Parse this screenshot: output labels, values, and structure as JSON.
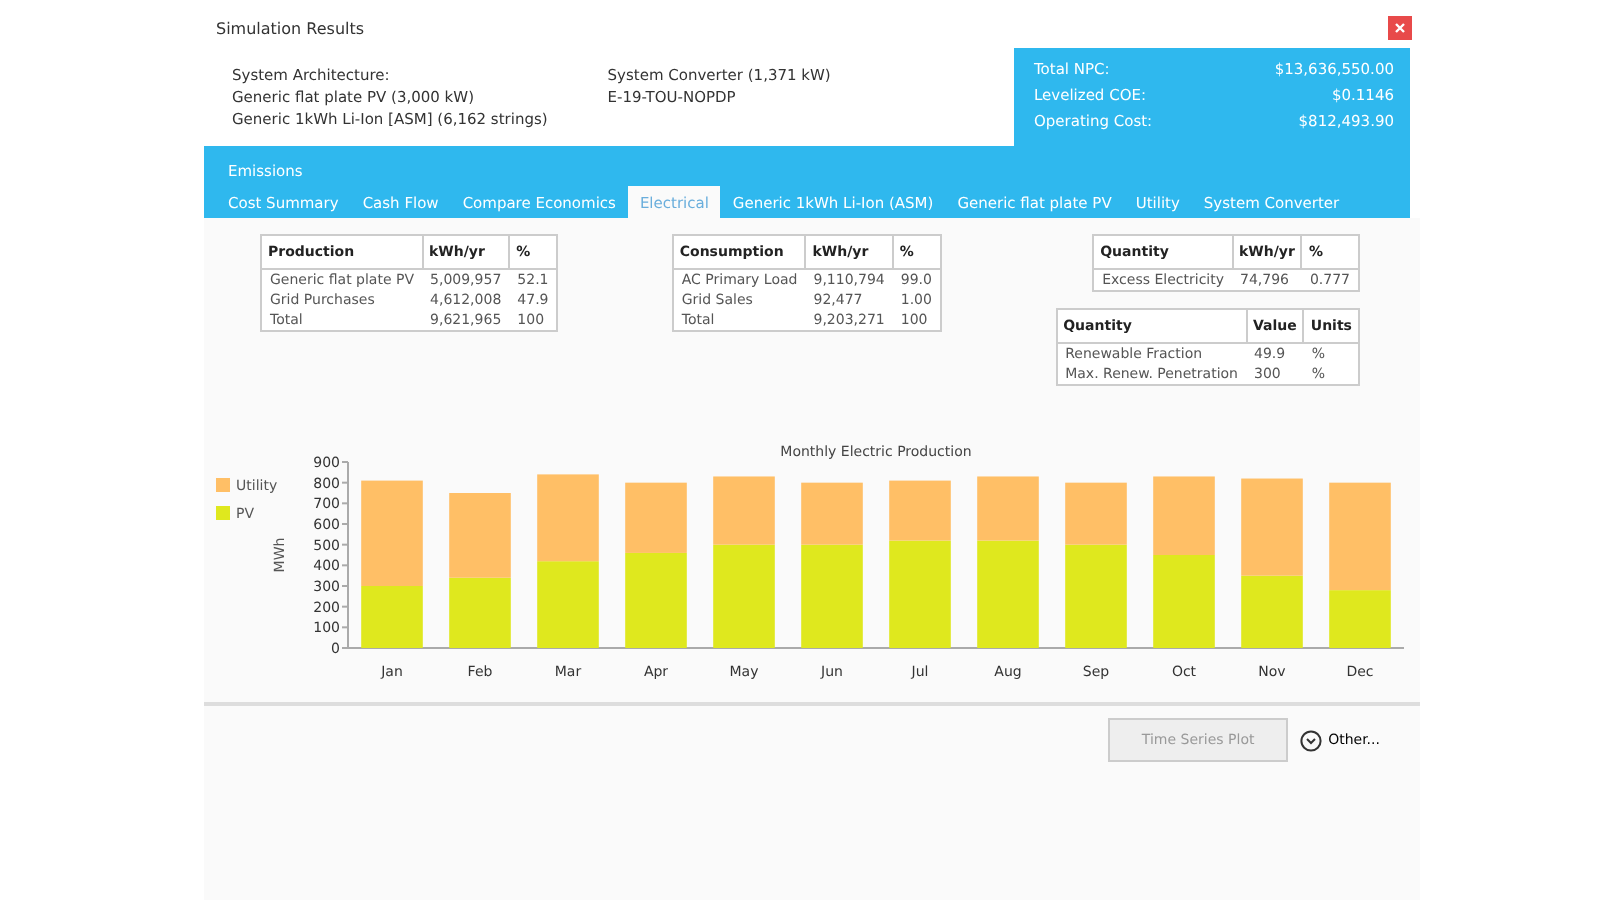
{
  "window": {
    "title": "Simulation Results"
  },
  "architecture": {
    "column_1": [
      "System Architecture:",
      "Generic flat plate PV (3,000 kW)",
      "Generic 1kWh Li-Ion [ASM] (6,162 strings)"
    ],
    "column_2": [
      "System Converter (1,371 kW)",
      "E-19-TOU-NOPDP"
    ]
  },
  "summary": [
    {
      "label": "Total NPC:",
      "value": "$13,636,550.00"
    },
    {
      "label": "Levelized COE:",
      "value": "$0.1146"
    },
    {
      "label": "Operating Cost:",
      "value": "$812,493.90"
    }
  ],
  "tab_rows": [
    [
      {
        "label": "Emissions",
        "selected": false
      }
    ],
    [
      {
        "label": "Cost Summary",
        "selected": false
      },
      {
        "label": "Cash Flow",
        "selected": false
      },
      {
        "label": "Compare Economics",
        "selected": false
      },
      {
        "label": "Electrical",
        "selected": true
      },
      {
        "label": "Generic 1kWh Li-Ion (ASM)",
        "selected": false
      },
      {
        "label": "Generic flat plate PV",
        "selected": false
      },
      {
        "label": "Utility",
        "selected": false
      },
      {
        "label": "System Converter",
        "selected": false
      }
    ]
  ],
  "tables": [
    {
      "columns": [
        "Production",
        "kWh/yr",
        "%"
      ],
      "rows": [
        [
          "Generic flat plate PV",
          "5,009,957",
          "52.1"
        ],
        [
          "Grid Purchases",
          "4,612,008",
          "47.9"
        ],
        [
          "Total",
          "9,621,965",
          "100"
        ]
      ]
    },
    {
      "columns": [
        "Consumption",
        "kWh/yr",
        "%"
      ],
      "rows": [
        [
          "AC Primary Load",
          "9,110,794",
          "99.0"
        ],
        [
          "Grid Sales",
          "92,477",
          "1.00"
        ],
        [
          "Total",
          "9,203,271",
          "100"
        ]
      ]
    },
    {
      "columns": [
        "Quantity",
        "kWh/yr",
        "%"
      ],
      "rows": [
        [
          "Excess Electricity",
          "74,796",
          "0.777"
        ]
      ]
    },
    {
      "columns": [
        "Quantity",
        "Value",
        "Units"
      ],
      "rows": [
        [
          "Renewable Fraction",
          "49.9",
          "%"
        ],
        [
          "Max. Renew. Penetration",
          "300",
          "%"
        ]
      ]
    }
  ],
  "chart_data": {
    "type": "bar",
    "title": "Monthly Electric Production",
    "ylabel": "MWh",
    "stacked": true,
    "categories": [
      "Jan",
      "Feb",
      "Mar",
      "Apr",
      "May",
      "Jun",
      "Jul",
      "Aug",
      "Sep",
      "Oct",
      "Nov",
      "Dec"
    ],
    "series": [
      {
        "name": "PV",
        "color": "#dfe81e",
        "values": [
          300,
          340,
          420,
          460,
          500,
          500,
          520,
          520,
          500,
          450,
          350,
          280
        ]
      },
      {
        "name": "Utility",
        "color": "#ffbf66",
        "values": [
          510,
          410,
          420,
          340,
          330,
          300,
          290,
          310,
          300,
          380,
          470,
          520
        ]
      }
    ],
    "legend": true,
    "ylim": [
      0,
      900
    ],
    "yticks": [
      0,
      100,
      200,
      300,
      400,
      500,
      600,
      700,
      800,
      900
    ]
  },
  "buttons": [
    {
      "label": "Time Series Plot",
      "disabled": true
    },
    {
      "label": "Other...",
      "disabled": false
    }
  ]
}
